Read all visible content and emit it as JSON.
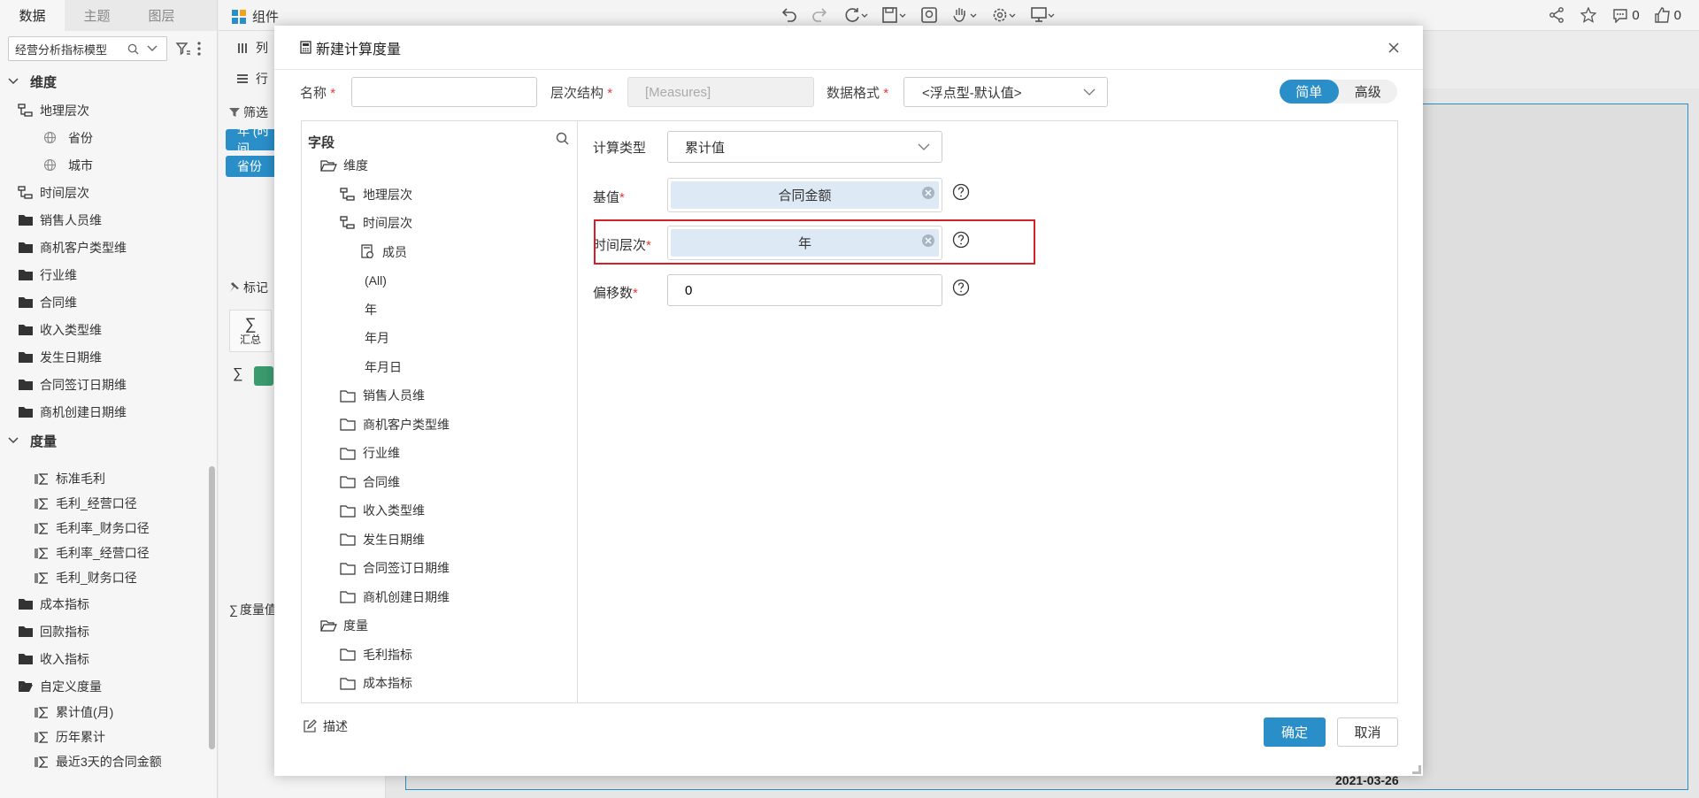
{
  "left_panel": {
    "tabs": [
      "数据",
      "主题",
      "图层"
    ],
    "model_select": "经营分析指标模型",
    "dimension_section": "维度",
    "dimensions": [
      {
        "label": "地理层次",
        "icon": "hierarchy-icon",
        "indent": 0
      },
      {
        "label": "省份",
        "icon": "globe-icon",
        "indent": 1
      },
      {
        "label": "城市",
        "icon": "globe-icon",
        "indent": 1
      },
      {
        "label": "时间层次",
        "icon": "hierarchy-icon",
        "indent": 0
      },
      {
        "label": "销售人员维",
        "icon": "folder-icon",
        "indent": 0
      },
      {
        "label": "商机客户类型维",
        "icon": "folder-icon",
        "indent": 0
      },
      {
        "label": "行业维",
        "icon": "folder-icon",
        "indent": 0
      },
      {
        "label": "合同维",
        "icon": "folder-icon",
        "indent": 0
      },
      {
        "label": "收入类型维",
        "icon": "folder-icon",
        "indent": 0
      },
      {
        "label": "发生日期维",
        "icon": "folder-icon",
        "indent": 0
      },
      {
        "label": "合同签订日期维",
        "icon": "folder-icon",
        "indent": 0
      },
      {
        "label": "商机创建日期维",
        "icon": "folder-icon",
        "indent": 0
      }
    ],
    "measure_section": "度量",
    "measures": [
      {
        "label": "标准毛利",
        "icon": "sigma-icon",
        "indent": 1
      },
      {
        "label": "毛利_经营口径",
        "icon": "sigma-icon",
        "indent": 1
      },
      {
        "label": "毛利率_财务口径",
        "icon": "sigma-icon",
        "indent": 1
      },
      {
        "label": "毛利率_经营口径",
        "icon": "sigma-icon",
        "indent": 1
      },
      {
        "label": "毛利_财务口径",
        "icon": "sigma-icon",
        "indent": 1
      },
      {
        "label": "成本指标",
        "icon": "folder-icon",
        "indent": 0
      },
      {
        "label": "回款指标",
        "icon": "folder-icon",
        "indent": 0
      },
      {
        "label": "收入指标",
        "icon": "folder-icon",
        "indent": 0
      },
      {
        "label": "自定义度量",
        "icon": "folder-open-icon",
        "indent": 0
      },
      {
        "label": "累计值(月)",
        "icon": "sigma-icon",
        "indent": 1
      },
      {
        "label": "历年累计",
        "icon": "sigma-icon",
        "indent": 1
      },
      {
        "label": "最近3天的合同金额",
        "icon": "sigma-icon",
        "indent": 1
      }
    ]
  },
  "middle": {
    "component_label": "组件",
    "col_label": "列",
    "row_label": "行",
    "filter_label": "筛选",
    "filter_pills": [
      "年 (时间",
      "省份"
    ],
    "mark_label": "标记",
    "summary_label": "汇总",
    "measure_label": "度量值"
  },
  "topbar": {
    "comment_count": "0",
    "like_count": "0"
  },
  "canvas": {
    "date_text": "2021-03-26"
  },
  "dialog": {
    "title": "新建计算度量",
    "name_label": "名称",
    "name_value": "",
    "hierarchy_label": "层次结构",
    "hierarchy_placeholder": "[Measures]",
    "format_label": "数据格式",
    "format_value": "<浮点型-默认值>",
    "mode_simple": "简单",
    "mode_advanced": "高级",
    "field_tree_title": "字段",
    "field_tree": [
      {
        "label": "维度",
        "icon": "folder-open-icon",
        "level": 0
      },
      {
        "label": "地理层次",
        "icon": "hierarchy-icon",
        "level": 1
      },
      {
        "label": "时间层次",
        "icon": "hierarchy-icon",
        "level": 1
      },
      {
        "label": "成员",
        "icon": "member-icon",
        "level": 2
      },
      {
        "label": "(All)",
        "icon": "",
        "level": 2
      },
      {
        "label": "年",
        "icon": "",
        "level": 2
      },
      {
        "label": "年月",
        "icon": "",
        "level": 2
      },
      {
        "label": "年月日",
        "icon": "",
        "level": 2
      },
      {
        "label": "销售人员维",
        "icon": "folder-icon",
        "level": 1
      },
      {
        "label": "商机客户类型维",
        "icon": "folder-icon",
        "level": 1
      },
      {
        "label": "行业维",
        "icon": "folder-icon",
        "level": 1
      },
      {
        "label": "合同维",
        "icon": "folder-icon",
        "level": 1
      },
      {
        "label": "收入类型维",
        "icon": "folder-icon",
        "level": 1
      },
      {
        "label": "发生日期维",
        "icon": "folder-icon",
        "level": 1
      },
      {
        "label": "合同签订日期维",
        "icon": "folder-icon",
        "level": 1
      },
      {
        "label": "商机创建日期维",
        "icon": "folder-icon",
        "level": 1
      },
      {
        "label": "度量",
        "icon": "folder-open-icon",
        "level": 0
      },
      {
        "label": "毛利指标",
        "icon": "folder-icon",
        "level": 1
      },
      {
        "label": "成本指标",
        "icon": "folder-icon",
        "level": 1
      }
    ],
    "calc_type_label": "计算类型",
    "calc_type_value": "累计值",
    "base_label": "基值",
    "base_value": "合同金额",
    "time_label": "时间层次",
    "time_value": "年",
    "offset_label": "偏移数",
    "offset_value": "0",
    "describe_label": "描述",
    "ok_label": "确定",
    "cancel_label": "取消",
    "accent_color": "#2a8ec9",
    "highlight_color": "#d8202a"
  }
}
